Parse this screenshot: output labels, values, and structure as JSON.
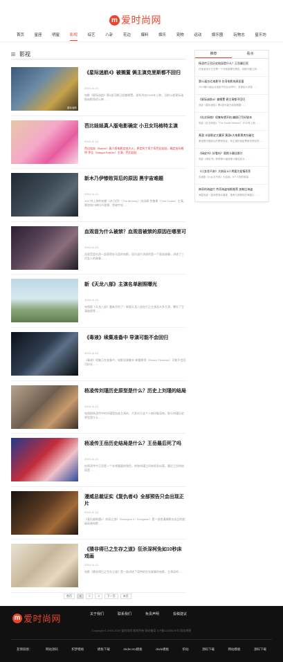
{
  "brand": {
    "logo_mark": "m",
    "logo_text": "爱时尚网"
  },
  "nav": [
    "首页",
    "星座",
    "明星",
    "影视",
    "综艺",
    "八卦",
    "花边",
    "爆料",
    "娱乐",
    "宠物",
    "运动",
    "娱乐圈",
    "玩物志",
    "星乐坊"
  ],
  "nav_active": 3,
  "section": {
    "title": "影视"
  },
  "articles": [
    {
      "title": "《星际迷航4》被搁置 俩主演克里斯都不回归",
      "date": "2019-11-21",
      "summary": "电影《星际迷航》第4部可能已经被搁置。该系列自2009年上映，当前11部星际迷航电影陆续公映……",
      "thumb_tag": "星际迷航",
      "red": false
    },
    {
      "title": "芭比娃娃真人版电影确定 小丑女玛格特主演",
      "date": "2019-11-21",
      "summary": "芭比娃娃（Barbie）真人版电影定档大火，原定的丁寿丁寿芭比娃娃，确定由玛格特·罗比（Margot Robbie）主演，芭比娃娃……",
      "thumb_tag": "",
      "red": true
    },
    {
      "title": "新木乃伊惨败背后的原因 黑宇宙难题",
      "date": "2019-11-21",
      "summary": "2017年上映的电影《木乃伊》（The Mummy）由汤姆·克鲁斯（Tom Cruise）主演，票房和口碑均不理想，黑暗宇宙……",
      "thumb_tag": "",
      "red": false
    },
    {
      "title": "血观音为什么被禁？血观音被禁的原因在哪里可",
      "date": "2019-11-21",
      "summary": "血观音是台湾一部获得金马奖的电影，因为该片讲述的是一个家族故事，讲述了三代女人的故事……",
      "thumb_tag": "",
      "red": false
    },
    {
      "title": "新《天龙八部》主演名单剧照曝光",
      "date": "2019-11-21",
      "summary": "电视剧《天龙八部》重新开拍了！新版天龙八部由于正主演及众多主演，曝光了主演剧照等……",
      "thumb_tag": "",
      "red": false
    },
    {
      "title": "《毒液》续集准备中 导演可能不会回归",
      "date": "2019-11-21",
      "summary": "《毒液》续集正在准备中，电影导演鲁本·弗雷斯彻（Ruben Fleischer）可能不会回归执导……",
      "thumb_tag": "",
      "red": false
    },
    {
      "title": "杨凌传刘瑾历史原型是什么？历史上刘瑾的结局",
      "date": "2019-11-21",
      "summary": "电视剧杨凌传中的刘瑾是由谁主演的，大家对于这个人物印象深刻，那么刘瑾历史原型是什么……",
      "thumb_tag": "",
      "red": false
    },
    {
      "title": "杨凌传王岳历史结局是什么？王岳最后死了吗",
      "date": "2019-11-21",
      "summary": "在杨凌传中王岳是一个非常重要的角色，他和刘瑾之间有很多纠葛，最后王岳的结局是……",
      "thumb_tag": "",
      "red": false
    },
    {
      "title": "漫威总裁证实《复仇者4》全部预告只会出现正片",
      "date": "2019-11-21",
      "summary": "《复仇者联盟4：终局之战》（Avengers 4：Endgame）是一部由漫威影业出品的超级英雄电影……",
      "thumb_tag": "",
      "red": false
    },
    {
      "title": "《猜非得已之生存之道》狂杀深柯免如10秒床戏画",
      "date": "2019-11-21",
      "summary": "电影《猜非得已之生存之道》是一部讲述了奇特的生存故事的电影，主演深柯……",
      "thumb_tag": "",
      "red": false
    }
  ],
  "pagination": {
    "first": "首页",
    "pages": [
      "1",
      "2",
      "3"
    ],
    "current": "1",
    "next": "下一页",
    "last": "末页"
  },
  "sidebar": {
    "tabs": [
      "推荐",
      "看点"
    ],
    "items": [
      {
        "title": "杨凌传王岳历史结局是什么？王岳最后死",
        "sub": "在杨凌传中王岳是一个非常重要的角色，他和刘瑾之间……"
      },
      {
        "title": "第21届台北电影节 台湾电影成绩显著",
        "sub": "2019第21届台北电影节在台北举行，多部影片获奖……"
      },
      {
        "title": "《星际迷航4》被搁置 俩主演都不回归",
        "sub": "电影《星际迷航》第4部可能已经被搁置……"
      },
      {
        "title": "《社交网络》续集有望开拍 编剧已写好剧本",
        "sub": "电影《社交网络》（The Social Network）2010年上映……"
      },
      {
        "title": "黄渤 半部影史大赢家 黄渤6大电影票房均破亿",
        "sub": "黄渤是中国影坛的票房保证，他主演的电影票房成绩优异……"
      },
      {
        "title": "《绿皮书》好看吗？奥斯卡最佳影片",
        "sub": "电影《绿皮书》获得第91届奥斯卡最佳影片……"
      },
      {
        "title": "《小女花不弃》大结局 8人将要为爱情而死",
        "sub": "电视剧《小女花不弃》大结局，8个人物的故事……"
      },
      {
        "title": "神奇的海盗片 传奇海盗电影推荐 加勒比海盗",
        "sub": "海盗电影一直深受观众喜爱，推荐几部精彩的海盗片……"
      }
    ]
  },
  "footer": {
    "links": [
      "关于我们",
      "联系我们",
      "免责声明",
      "投稿建议"
    ],
    "copyright": "Copyright © 2002-2019 爱时尚网 版权所有 网站备案 ICP备12345678号 网站地图",
    "friends_label": "友情链接：",
    "friends": [
      "网站源码",
      "织梦模板",
      "模板下载",
      "dedecms模板",
      "dede模板",
      "织站",
      "源码下载",
      "网站模板",
      "源码下载"
    ]
  },
  "colors": {
    "accent": "#e8452c",
    "footer_bg": "#111111"
  }
}
